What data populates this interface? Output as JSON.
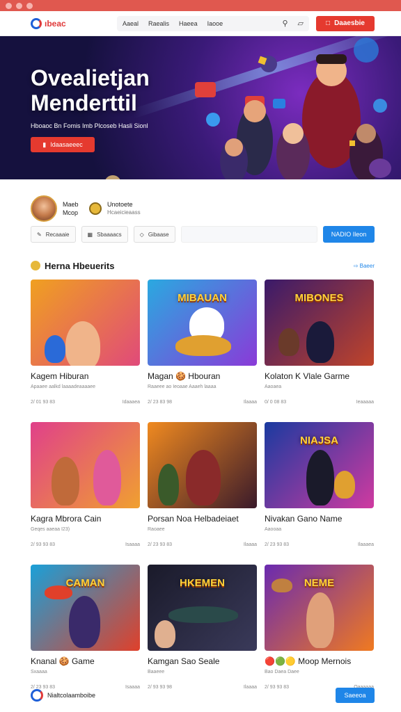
{
  "window": {
    "title_bar_color": "#e0584f"
  },
  "nav": {
    "logo_text": "ıbeac",
    "links": [
      "Aaeal",
      "Raealis",
      "Haeea",
      "Iaooe"
    ],
    "search_icon": "search-icon",
    "bag_icon": "bag-icon",
    "cta_label": "Daaesbie"
  },
  "hero": {
    "title_line1": "Ovealietjan",
    "title_line2": "Menderttil",
    "subtitle": "Hboaoc Bn Fomis Imb Plcoseb Hasli Sionl",
    "button_label": "Idaasaeeec"
  },
  "profile": {
    "name_line1": "Maeb",
    "name_line2": "Mcop",
    "title": "Unotoete",
    "subtitle": "Hcaeicieaass"
  },
  "toolbar": {
    "chips": [
      "Recaaaie",
      "Sbaaaacs",
      "Gibaase"
    ],
    "search_placeholder": "",
    "search_button": "NADIO Ileon"
  },
  "section": {
    "title": "Herna Hbeuerits",
    "see_all": "Baeer"
  },
  "cards": [
    {
      "title": "Kagem Hiburan",
      "sub": "Apaaee aalkd laaaadeaaaaee",
      "date": "2/ 01 93 83",
      "tag": "Idaaaea",
      "banner": "",
      "bg": [
        "#f0a020",
        "#e04a7a"
      ]
    },
    {
      "title": "Magan 🍪 Hbouran",
      "sub": "Raaeee ao Ieoaae Aaaeh laaaa",
      "date": "2/ 23 83 98",
      "tag": "Ilaaaa",
      "banner": "MIBAUAN",
      "bg": [
        "#2aa9e0",
        "#8a3ad8"
      ]
    },
    {
      "title": "Kolaton K Vlale Garme",
      "sub": "Aaoaea",
      "date": "0/ 0 08 83",
      "tag": "Ieaaaaa",
      "banner": "MIBONES",
      "bg": [
        "#3a1a6a",
        "#c0442a"
      ]
    },
    {
      "title": "Kagra Mbrora Cain",
      "sub": "Geqes aaeaa I23)",
      "date": "2/ 93 93 83",
      "tag": "Isaaaa",
      "banner": "",
      "bg": [
        "#e0408a",
        "#f0a030"
      ]
    },
    {
      "title": "Porsan Noa Helbadeiaet",
      "sub": "Raoaee",
      "date": "2/ 23 93 83",
      "tag": "Ilaaaa",
      "banner": "",
      "bg": [
        "#f08a20",
        "#3a1a2a"
      ]
    },
    {
      "title": "Nivakan Gano Name",
      "sub": "Aaooaa",
      "date": "2/ 23 93 83",
      "tag": "Ilaaaea",
      "banner": "NIAJSA",
      "bg": [
        "#1a3aa0",
        "#d03aa0"
      ]
    },
    {
      "title": "Knanal 🍪 Game",
      "sub": "Sxaaaa",
      "date": "2/ 23 93 83",
      "tag": "Isaaaa",
      "banner": "CAMAN",
      "bg": [
        "#1aa0d8",
        "#e0402a"
      ]
    },
    {
      "title": "Kamgan Sao Seale",
      "sub": "Baaeee",
      "date": "2/ 93 93 98",
      "tag": "Ilaaaa",
      "banner": "HKEMEN",
      "bg": [
        "#1a1a2a",
        "#3a3a5a"
      ]
    },
    {
      "title": "🔴🟢🟡 Moop Mernois",
      "sub": "Bao Daea Daee",
      "date": "2/ 93 93 83",
      "tag": "Oaaaaaa",
      "banner": "NEME",
      "bg": [
        "#6a2ab0",
        "#f07a20"
      ]
    }
  ],
  "footer": {
    "text": "Nialtcolaamboibe",
    "button": "Saeeoa"
  },
  "colors": {
    "accent_red": "#e53a2f",
    "accent_blue": "#1f86e8"
  }
}
